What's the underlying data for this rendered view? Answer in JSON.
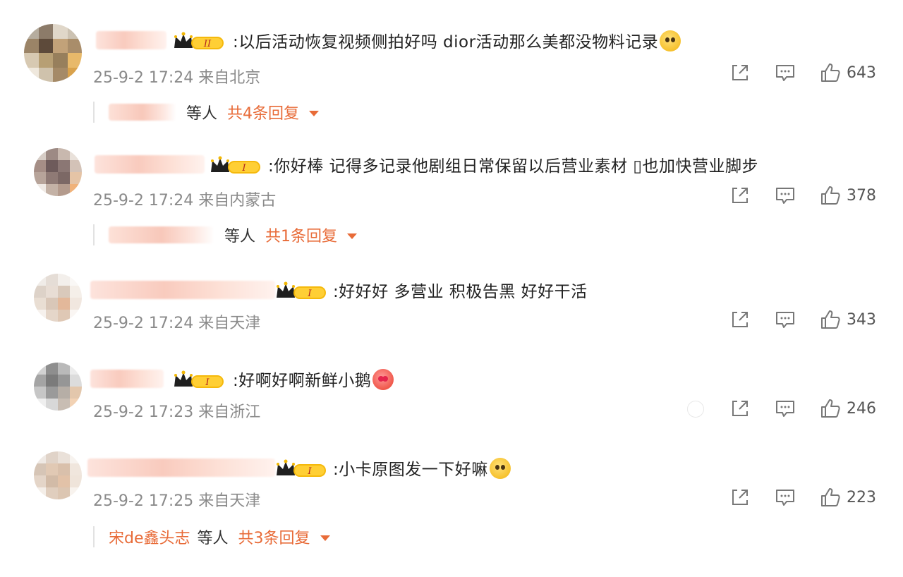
{
  "comments": [
    {
      "text": ":以后活动恢复视频侧拍好吗 dior活动那么美都没物料记录",
      "emoji": "flushed",
      "timestamp": "25-9-2 17:24",
      "location": "来自北京",
      "likes": "643",
      "badge": "II",
      "replies": {
        "mid": "等人",
        "count": "共4条回复"
      }
    },
    {
      "text": ":你好棒 记得多记录他剧组日常保留以后营业素材 ▯也加快营业脚步",
      "timestamp": "25-9-2 17:24",
      "location": "来自内蒙古",
      "likes": "378",
      "badge": "I",
      "replies": {
        "mid": "等人",
        "count": "共1条回复"
      }
    },
    {
      "text": ":好好好 多营业 积极告黑 好好干活",
      "timestamp": "25-9-2 17:24",
      "location": "来自天津",
      "likes": "343",
      "badge": "I"
    },
    {
      "text": ":好啊好啊新鲜小鹅",
      "emoji": "heart-eyes",
      "timestamp": "25-9-2 17:23",
      "location": "来自浙江",
      "likes": "246",
      "badge": "I"
    },
    {
      "text": ":小卡原图发一下好嘛",
      "emoji": "pleading",
      "timestamp": "25-9-2 17:25",
      "location": "来自天津",
      "likes": "223",
      "badge": "I",
      "replies": {
        "name": "宋de鑫头志",
        "mid": "等人",
        "count": "共3条回复"
      }
    }
  ],
  "icons": {
    "share": "share-icon",
    "comment": "comment-icon",
    "like": "thumbs-up-icon",
    "badge": "crown-badge-icon"
  },
  "colors": {
    "accent": "#e86b38",
    "text": "#222222",
    "meta": "#8a8a8a",
    "badge_gold": "#f2b705"
  }
}
